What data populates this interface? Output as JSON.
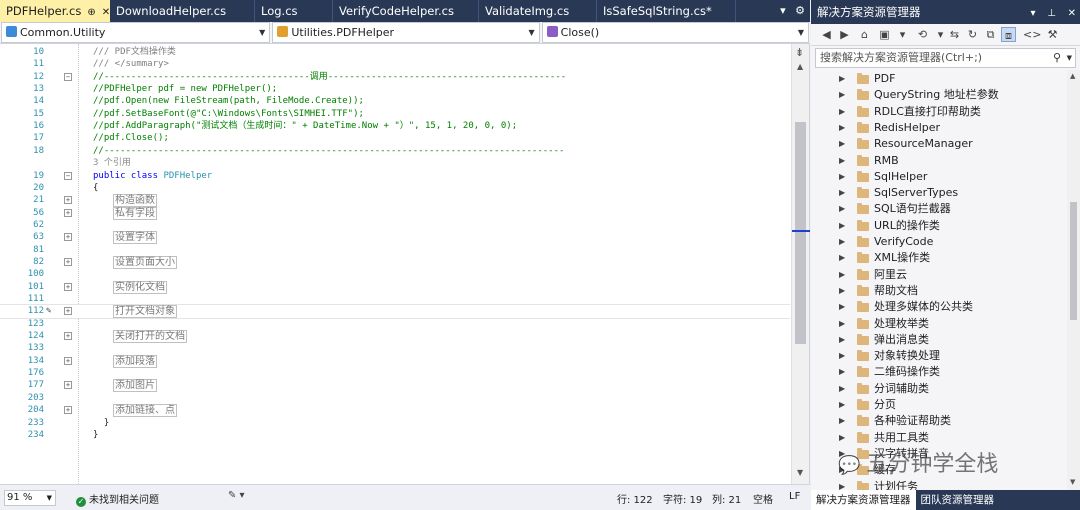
{
  "editor": {
    "tabs": [
      {
        "label": "PDFHelper.cs",
        "active": true
      },
      {
        "label": "DownloadHelper.cs",
        "active": false
      },
      {
        "label": "Log.cs",
        "active": false
      },
      {
        "label": "VerifyCodeHelper.cs",
        "active": false
      },
      {
        "label": "ValidateImg.cs",
        "active": false
      },
      {
        "label": "IsSafeSqlString.cs*",
        "active": false
      }
    ],
    "nav": {
      "project": "Common.Utility",
      "class": "Utilities.PDFHelper",
      "member": "Close()"
    },
    "lines": [
      {
        "n": "10",
        "parts": [
          {
            "c": "c-doc",
            "t": "/// PDF文档操作类"
          }
        ]
      },
      {
        "n": "11",
        "parts": [
          {
            "c": "c-doc",
            "t": "/// </summary>"
          }
        ]
      },
      {
        "n": "12",
        "parts": [
          {
            "c": "c-comment",
            "t": "//--------------------------------------调用--------------------------------------------"
          }
        ],
        "fold": true
      },
      {
        "n": "13",
        "parts": [
          {
            "c": "c-comment",
            "t": "//PDFHelper pdf = new PDFHelper();"
          }
        ]
      },
      {
        "n": "14",
        "parts": [
          {
            "c": "c-comment",
            "t": "//pdf.Open(new FileStream(path, FileMode.Create));"
          }
        ]
      },
      {
        "n": "15",
        "parts": [
          {
            "c": "c-comment",
            "t": "//pdf.SetBaseFont(@\"C:\\Windows\\Fonts\\SIMHEI.TTF\");"
          }
        ]
      },
      {
        "n": "16",
        "parts": [
          {
            "c": "c-comment",
            "t": "//pdf.AddParagraph(\"测试文档（生成时间：\" + DateTime.Now + \"）\", 15, 1, 20, 0, 0);"
          }
        ]
      },
      {
        "n": "17",
        "parts": [
          {
            "c": "c-comment",
            "t": "//pdf.Close();"
          }
        ]
      },
      {
        "n": "18",
        "parts": [
          {
            "c": "c-comment",
            "t": "//-------------------------------------------------------------------------------------"
          }
        ]
      },
      {
        "n": "",
        "parts": [
          {
            "c": "c-ref",
            "t": "3 个引用"
          }
        ]
      },
      {
        "n": "19",
        "parts": [
          {
            "c": "c-kw",
            "t": "public class "
          },
          {
            "c": "c-type",
            "t": "PDFHelper"
          }
        ],
        "fold": true
      },
      {
        "n": "20",
        "parts": [
          {
            "c": "c-plain",
            "t": "{"
          }
        ]
      },
      {
        "n": "21",
        "region": "构造函数",
        "fold": true
      },
      {
        "n": "56",
        "region": "私有字段",
        "fold": true
      },
      {
        "n": "62",
        "region": "",
        "fold": false
      },
      {
        "n": "63",
        "region": "设置字体",
        "fold": true
      },
      {
        "n": "81",
        "region": "",
        "fold": false
      },
      {
        "n": "82",
        "region": "设置页面大小",
        "fold": true
      },
      {
        "n": "100",
        "region": "",
        "fold": false
      },
      {
        "n": "101",
        "region": "实例化文档",
        "fold": true
      },
      {
        "n": "111",
        "region": "",
        "fold": false
      },
      {
        "n": "112",
        "region": "打开文档对象",
        "fold": true,
        "current": true
      },
      {
        "n": "123",
        "region": "",
        "fold": false
      },
      {
        "n": "124",
        "region": "关闭打开的文档",
        "fold": true
      },
      {
        "n": "133",
        "region": "",
        "fold": false
      },
      {
        "n": "134",
        "region": "添加段落",
        "fold": true
      },
      {
        "n": "176",
        "region": "",
        "fold": false
      },
      {
        "n": "177",
        "region": "添加图片",
        "fold": true
      },
      {
        "n": "203",
        "region": "",
        "fold": false
      },
      {
        "n": "204",
        "region": "添加链接、点",
        "fold": true
      },
      {
        "n": "233",
        "parts": [
          {
            "c": "c-plain",
            "t": "  }"
          }
        ]
      },
      {
        "n": "234",
        "parts": [
          {
            "c": "c-plain",
            "t": "}"
          }
        ]
      }
    ],
    "status": {
      "zoom": "91 %",
      "issues": "未找到相关问题",
      "row": "行: 122",
      "char": "字符: 19",
      "col": "列: 21",
      "space": "空格",
      "eol": "LF"
    }
  },
  "explorer": {
    "title": "解决方案资源管理器",
    "search_placeholder": "搜索解决方案资源管理器(Ctrl+;)",
    "items": [
      "PDF",
      "QueryString 地址栏参数",
      "RDLC直接打印帮助类",
      "RedisHelper",
      "ResourceManager",
      "RMB",
      "SqlHelper",
      "SqlServerTypes",
      "SQL语句拦截器",
      "URL的操作类",
      "VerifyCode",
      "XML操作类",
      "阿里云",
      "帮助文档",
      "处理多媒体的公共类",
      "处理枚举类",
      "弹出消息类",
      "对象转换处理",
      "二维码操作类",
      "分词辅助类",
      "分页",
      "各种验证帮助类",
      "共用工具类",
      "汉字转拼音",
      "缓存",
      "计划任务"
    ],
    "bottom_tabs": [
      {
        "label": "解决方案资源管理器",
        "active": true
      },
      {
        "label": "团队资源管理器",
        "active": false
      }
    ]
  },
  "watermark": "五分钟学全栈",
  "colors": {
    "title_bar": "#293955",
    "active_tab": "#fff0a8",
    "comment": "#008000",
    "keyword": "#0000ff",
    "type": "#2b91af",
    "line_number": "#2b91af",
    "folder": "#dcb67a"
  },
  "icons": {
    "pin": "pin-icon",
    "close": "close-icon",
    "search": "search-icon",
    "folder": "folder-icon",
    "expand": "expand-arrow-icon"
  }
}
